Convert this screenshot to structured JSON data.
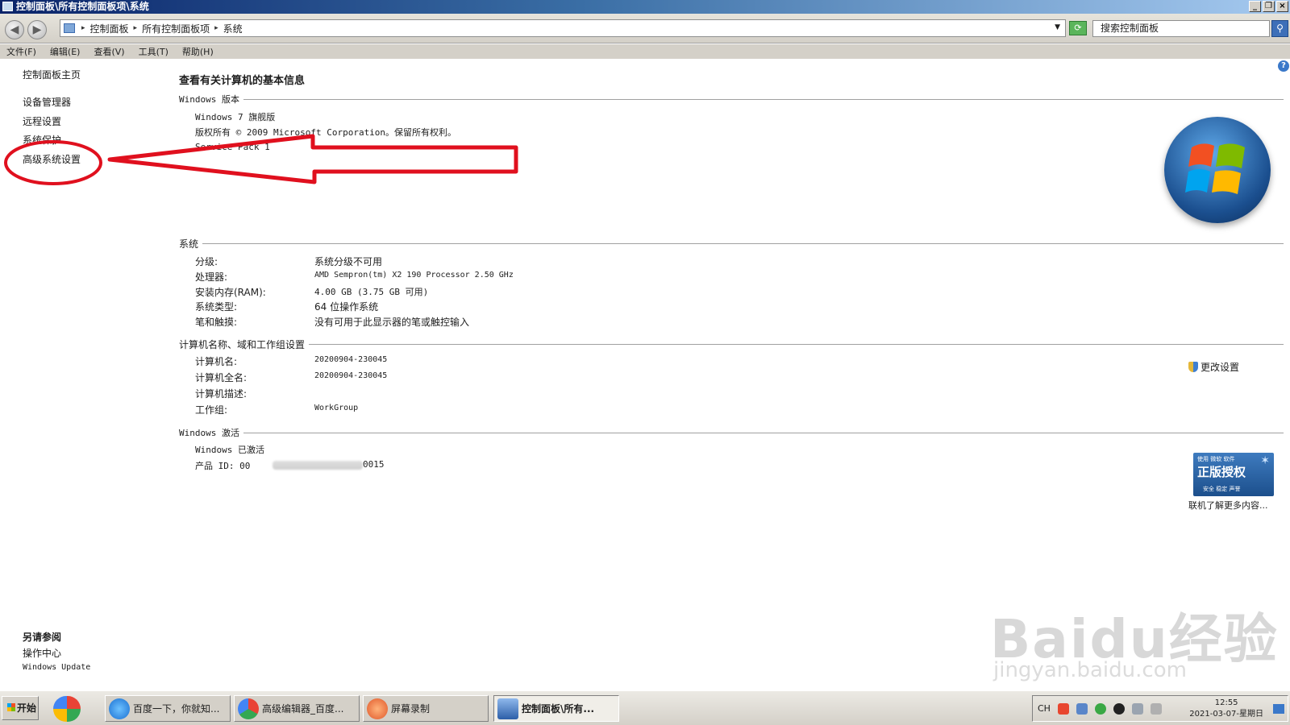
{
  "window": {
    "title": "控制面板\\所有控制面板项\\系统"
  },
  "address": {
    "crumbs": [
      "控制面板",
      "所有控制面板项",
      "系统"
    ],
    "search_placeholder": "搜索控制面板"
  },
  "menu": [
    "文件(F)",
    "编辑(E)",
    "查看(V)",
    "工具(T)",
    "帮助(H)"
  ],
  "sidebar": {
    "home": "控制面板主页",
    "items": [
      "设备管理器",
      "远程设置",
      "系统保护",
      "高级系统设置"
    ],
    "see_also_title": "另请参阅",
    "see_also": [
      "操作中心",
      "Windows Update"
    ]
  },
  "main": {
    "title": "查看有关计算机的基本信息",
    "edition": {
      "header": "Windows 版本",
      "name": "Windows 7 旗舰版",
      "copyright": "版权所有 © 2009 Microsoft Corporation。保留所有权利。",
      "service_pack": "Service Pack 1"
    },
    "system": {
      "header": "系统",
      "rows": [
        {
          "label": "分级:",
          "value": "系统分级不可用"
        },
        {
          "label": "处理器:",
          "value": "AMD Sempron(tm) X2 190 Processor   2.50 GHz"
        },
        {
          "label": "安装内存(RAM):",
          "value": "4.00 GB (3.75 GB 可用)"
        },
        {
          "label": "系统类型:",
          "value": "64 位操作系统"
        },
        {
          "label": "笔和触摸:",
          "value": "没有可用于此显示器的笔或触控输入"
        }
      ]
    },
    "computer": {
      "header": "计算机名称、域和工作组设置",
      "rows": [
        {
          "label": "计算机名:",
          "value": "20200904-230045"
        },
        {
          "label": "计算机全名:",
          "value": "20200904-230045"
        },
        {
          "label": "计算机描述:",
          "value": ""
        },
        {
          "label": "工作组:",
          "value": "WorkGroup"
        }
      ],
      "change_settings": "更改设置"
    },
    "activation": {
      "header": "Windows 激活",
      "status": "Windows 已激活",
      "product_id_label": "产品 ID: 00",
      "product_id_tail": "0015",
      "badge_top": "使用 微软 软件",
      "badge_main": "正版授权",
      "badge_sub": "安全 稳定 声誉",
      "more_online": "联机了解更多内容..."
    }
  },
  "taskbar": {
    "start": "开始",
    "tasks": [
      "百度一下，你就知...",
      "高级编辑器_百度...",
      "屏幕录制",
      "控制面板\\所有..."
    ],
    "lang": "CH",
    "time": "12:55",
    "date": "2021-03-07-星期日"
  },
  "watermark": {
    "main": "Baidu经验",
    "sub": "jingyan.baidu.com"
  },
  "colors": {
    "annotation_red": "#e0101e",
    "title_gradient_start": "#0a246a",
    "badge_blue": "#2a62a6"
  }
}
